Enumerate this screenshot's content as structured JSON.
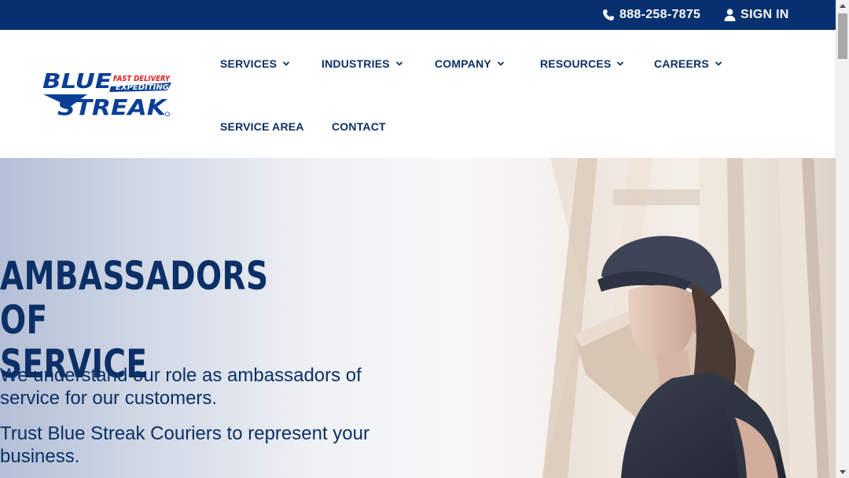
{
  "topbar": {
    "phone": "888-258-7875",
    "signin": "SIGN IN",
    "bg_color": "#06306f"
  },
  "logo": {
    "word1": "BLUE",
    "word2": "STREAK",
    "tag1": "FAST DELIVERY",
    "tag2": "EXPEDITING",
    "brand_blue": "#0b3f97",
    "brand_red": "#e21f26"
  },
  "nav": {
    "services": "SERVICES",
    "industries": "INDUSTRIES",
    "company": "COMPANY",
    "resources": "RESOURCES",
    "careers": "CAREERS",
    "service_area": "SERVICE AREA",
    "contact": "CONTACT"
  },
  "hero": {
    "title_line1": "AMBASSADORS OF",
    "title_line2": "SERVICE",
    "paragraph1": "We understand our role as ambassadors of service for our customers.",
    "paragraph2": "Trust Blue Streak Couriers to represent your business.",
    "text_color": "#0b2f66"
  },
  "icons": {
    "phone": "phone-icon",
    "user": "user-icon",
    "chevron": "chevron-down-icon"
  }
}
